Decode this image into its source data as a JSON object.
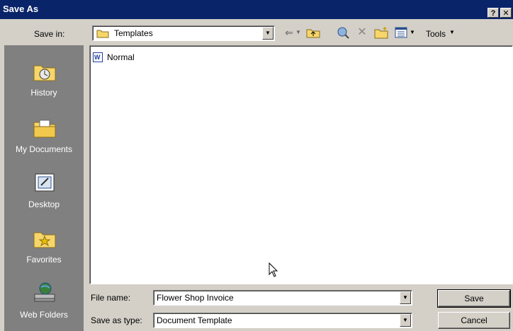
{
  "window": {
    "title": "Save As",
    "help_label": "?",
    "close_label": "✕"
  },
  "toolbar": {
    "save_in_label": "Save in:",
    "save_in_value": "Templates",
    "tools_label": "Tools"
  },
  "places": {
    "items": [
      {
        "label": "History",
        "icon": "history-icon"
      },
      {
        "label": "My Documents",
        "icon": "my-documents-icon"
      },
      {
        "label": "Desktop",
        "icon": "desktop-icon"
      },
      {
        "label": "Favorites",
        "icon": "favorites-icon"
      },
      {
        "label": "Web Folders",
        "icon": "web-folders-icon"
      }
    ]
  },
  "files": [
    {
      "name": "Normal",
      "icon": "word-document-icon"
    }
  ],
  "footer": {
    "file_name_label": "File name:",
    "file_name_value": "Flower Shop Invoice",
    "save_as_type_label": "Save as type:",
    "save_as_type_value": "Document Template",
    "save_button": "Save",
    "cancel_button": "Cancel"
  }
}
